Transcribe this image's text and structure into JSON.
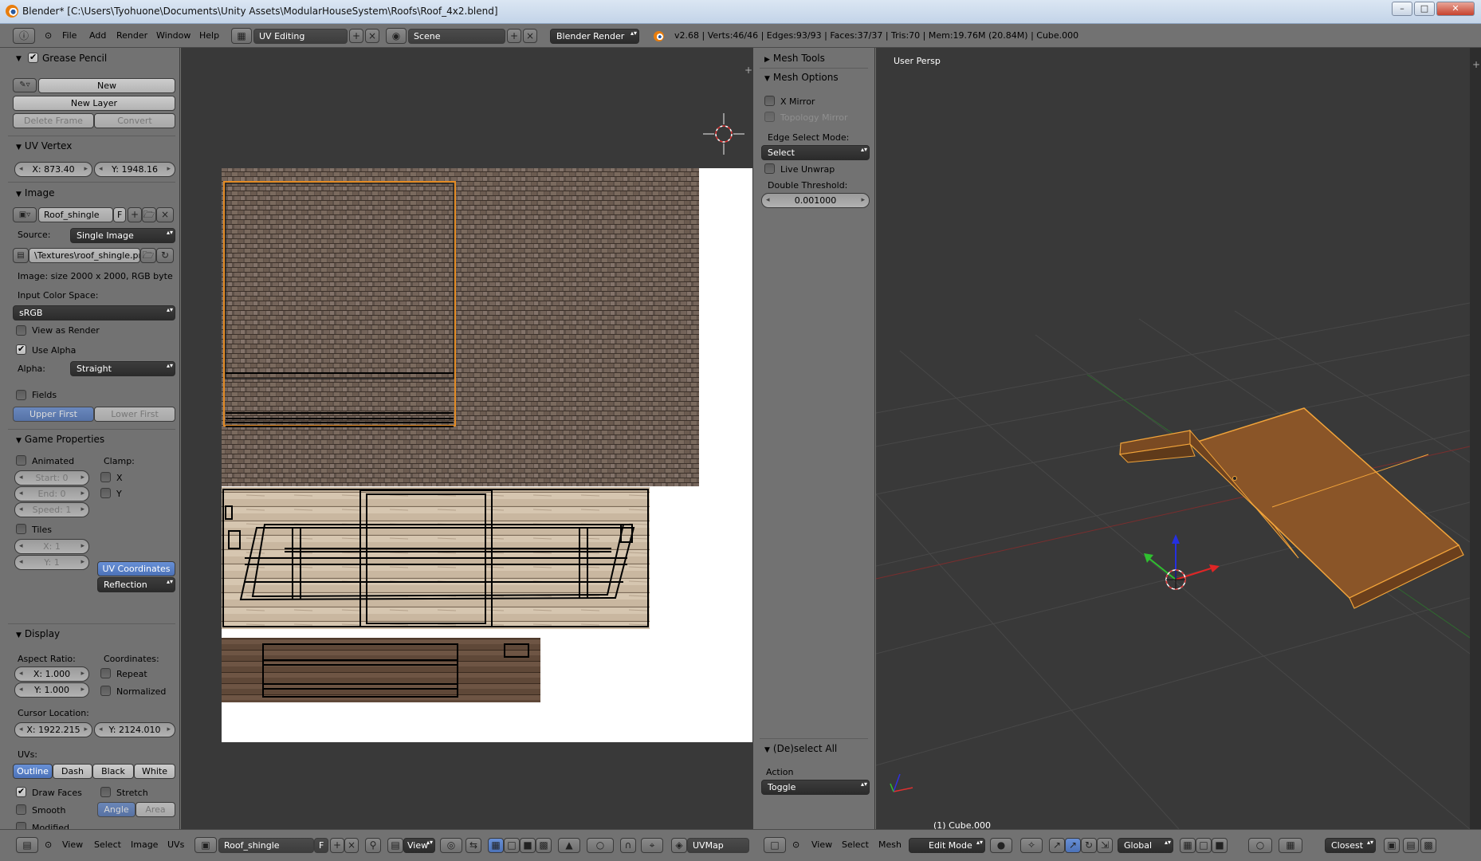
{
  "titlebar": {
    "title": "Blender* [C:\\Users\\Tyohuone\\Documents\\Unity Assets\\ModularHouseSystem\\Roofs\\Roof_4x2.blend]",
    "buttons": [
      "–",
      "□",
      "✕"
    ]
  },
  "infobar": {
    "menus": [
      "File",
      "Add",
      "Render",
      "Window",
      "Help"
    ],
    "layout": "UV Editing",
    "scene": "Scene",
    "engine": "Blender Render",
    "stats": "v2.68 | Verts:46/46 | Edges:93/93 | Faces:37/37 | Tris:70 | Mem:19.76M (20.84M) | Cube.000"
  },
  "left": {
    "grease": {
      "title": "Grease Pencil",
      "new": "New",
      "new_layer": "New Layer",
      "delete_frame": "Delete Frame",
      "convert": "Convert"
    },
    "uvvertex": {
      "title": "UV Vertex",
      "x": "X: 873.40",
      "y": "Y: 1948.16"
    },
    "image": {
      "title": "Image",
      "name": "Roof_shingle",
      "f": "F",
      "source_label": "Source:",
      "source": "Single Image",
      "path": "\\Textures\\roof_shingle.png",
      "info": "Image: size 2000 x 2000, RGB byte",
      "color_space_label": "Input Color Space:",
      "color_space": "sRGB",
      "view_as_render": "View as Render",
      "use_alpha": "Use Alpha",
      "alpha_label": "Alpha:",
      "alpha": "Straight",
      "fields": "Fields",
      "upper_first": "Upper First",
      "lower_first": "Lower First"
    },
    "game": {
      "title": "Game Properties",
      "animated": "Animated",
      "clamp": "Clamp:",
      "start": "Start: 0",
      "end": "End: 0",
      "speed": "Speed: 1",
      "cx": "X",
      "cy": "Y",
      "tiles": "Tiles",
      "tx": "X: 1",
      "ty": "Y: 1",
      "uv_coordinates": "UV Coordinates",
      "reflection": "Reflection"
    },
    "display": {
      "title": "Display",
      "aspect": "Aspect Ratio:",
      "ax": "X: 1.000",
      "ay": "Y: 1.000",
      "coords": "Coordinates:",
      "repeat": "Repeat",
      "normalized": "Normalized",
      "cursor": "Cursor Location:",
      "curx": "X: 1922.215",
      "cury": "Y: 2124.010",
      "uvs": "UVs:",
      "outline": "Outline",
      "dash": "Dash",
      "black": "Black",
      "white": "White",
      "draw_faces": "Draw Faces",
      "stretch": "Stretch",
      "smooth": "Smooth",
      "angle": "Angle",
      "area": "Area",
      "modified": "Modified"
    }
  },
  "tools": {
    "mesh_tools": "Mesh Tools",
    "mesh_options": "Mesh Options",
    "x_mirror": "X Mirror",
    "topology_mirror": "Topology Mirror",
    "edge_select_mode": "Edge Select Mode:",
    "edge_select": "Select",
    "live_unwrap": "Live Unwrap",
    "double_threshold": "Double Threshold:",
    "threshold": "0.001000",
    "deselect_all": "(De)select All",
    "action": "Action",
    "toggle": "Toggle"
  },
  "view3d": {
    "label": "User Persp",
    "object": "(1) Cube.000"
  },
  "footer": {
    "uv_menus": [
      "View",
      "Select",
      "Image",
      "UVs"
    ],
    "image_name": "Roof_shingle",
    "f": "F",
    "view": "View",
    "uvmap": "UVMap",
    "v3d_menus": [
      "View",
      "Select",
      "Mesh"
    ],
    "mode": "Edit Mode",
    "orientation": "Global",
    "snap": "Closest"
  },
  "colors": {
    "panel": "#727272",
    "viewport": "#393939",
    "accent": "#5680c2",
    "selection": "#f0a030"
  }
}
